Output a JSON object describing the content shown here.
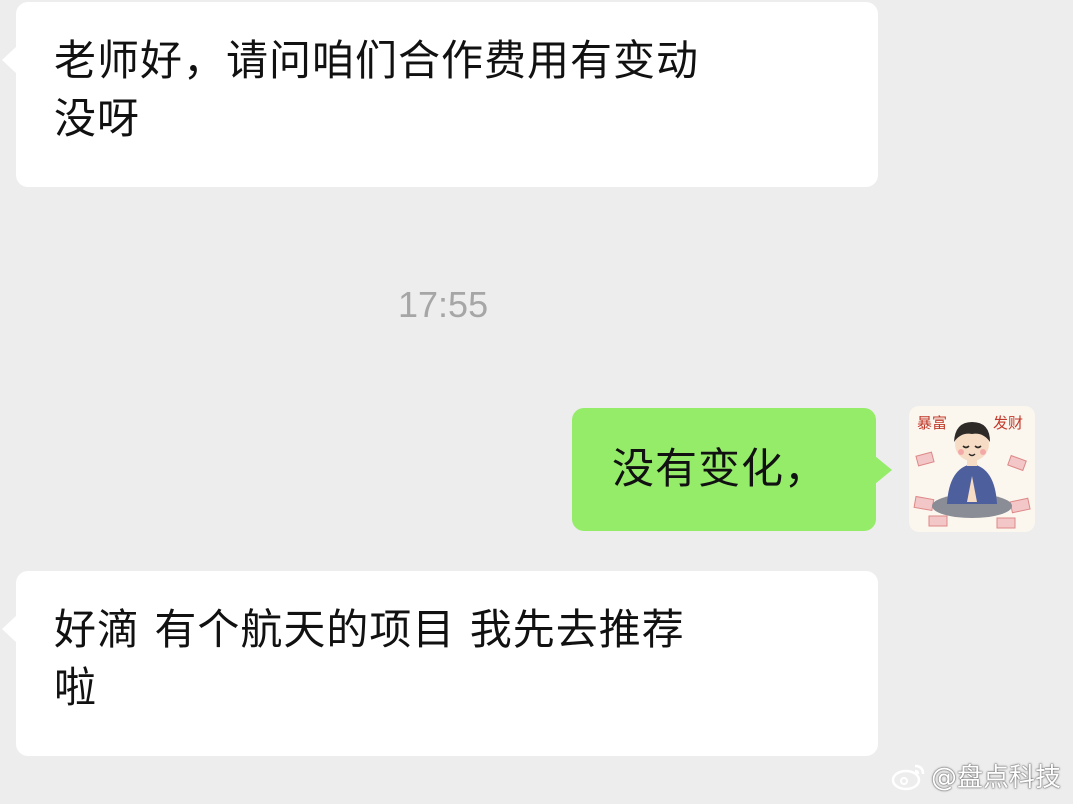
{
  "chat": {
    "messages": [
      {
        "sender": "other",
        "text": "老师好，请问咱们合作费用有变动\n没呀"
      },
      {
        "sender": "me",
        "text": "没有变化，"
      },
      {
        "sender": "other",
        "text": "好滴 有个航天的项目 我先去推荐\n啦"
      }
    ],
    "timestamp": "17:55",
    "avatar": {
      "icon": "avatar-praying-boy",
      "caption_left": "暴富",
      "caption_right": "发财"
    }
  },
  "watermark": {
    "icon": "weibo-icon",
    "text": "@盘点科技"
  },
  "colors": {
    "background": "#ededed",
    "incoming_bubble": "#ffffff",
    "outgoing_bubble": "#95ec69",
    "timestamp": "#a6a6a6"
  }
}
